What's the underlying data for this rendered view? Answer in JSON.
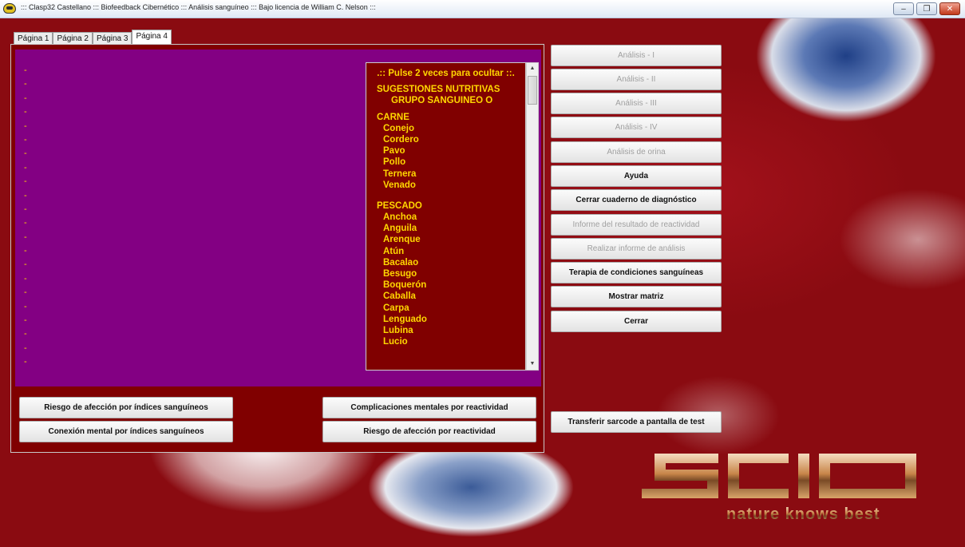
{
  "window": {
    "title": "::: Clasp32 Castellano ::: Biofeedback Cibernético ::: Análisis sanguíneo ::: Bajo licencia de William C. Nelson :::",
    "buttons": {
      "minimize": "–",
      "maximize": "❐",
      "close": "✕"
    }
  },
  "tabs": [
    "Página 1",
    "Página 2",
    "Página 3",
    "Página 4"
  ],
  "active_tab": "Página 4",
  "dash_char": "-",
  "dash_count": 22,
  "suggestions": {
    "header": ".:: Pulse 2 veces para ocultar ::.",
    "title_line1": "SUGESTIONES NUTRITIVAS",
    "title_line2": "GRUPO SANGUINEO O",
    "sections": [
      {
        "name": "CARNE",
        "items": [
          "Conejo",
          "Cordero",
          "Pavo",
          "Pollo",
          "Ternera",
          "Venado"
        ]
      },
      {
        "name": "PESCADO",
        "items": [
          "Anchoa",
          "Anguila",
          "Arenque",
          "Atún",
          "Bacalao",
          "Besugo",
          "Boquerón",
          "Caballa",
          "Carpa",
          "Lenguado",
          "Lubina",
          "Lucio"
        ]
      }
    ]
  },
  "bottom_buttons": {
    "risk_indices": "Riesgo de afección por índices sanguíneos",
    "mental_indices": "Conexión mental por índices sanguíneos",
    "mental_reactivity": "Complicaciones mentales por reactividad",
    "risk_reactivity": "Riesgo de afección por reactividad"
  },
  "right_buttons": {
    "analisis_1": "Análisis - I",
    "analisis_2": "Análisis - II",
    "analisis_3": "Análisis - III",
    "analisis_4": "Análisis - IV",
    "analisis_orina": "Análisis de orina",
    "ayuda": "Ayuda",
    "cerrar_cuaderno": "Cerrar cuaderno de diagnóstico",
    "informe_reactividad": "Informe del resultado de reactividad",
    "realizar_informe": "Realizar informe de análisis",
    "terapia": "Terapia de condiciones sanguíneas",
    "mostrar_matriz": "Mostrar matriz",
    "cerrar": "Cerrar",
    "transferir": "Transferir sarcode a pantalla de test"
  },
  "logo": {
    "main": "SCIO",
    "tagline": "nature knows best"
  },
  "colors": {
    "panel": "#800000",
    "purple": "#830083",
    "text_yellow": "#ffd700"
  }
}
